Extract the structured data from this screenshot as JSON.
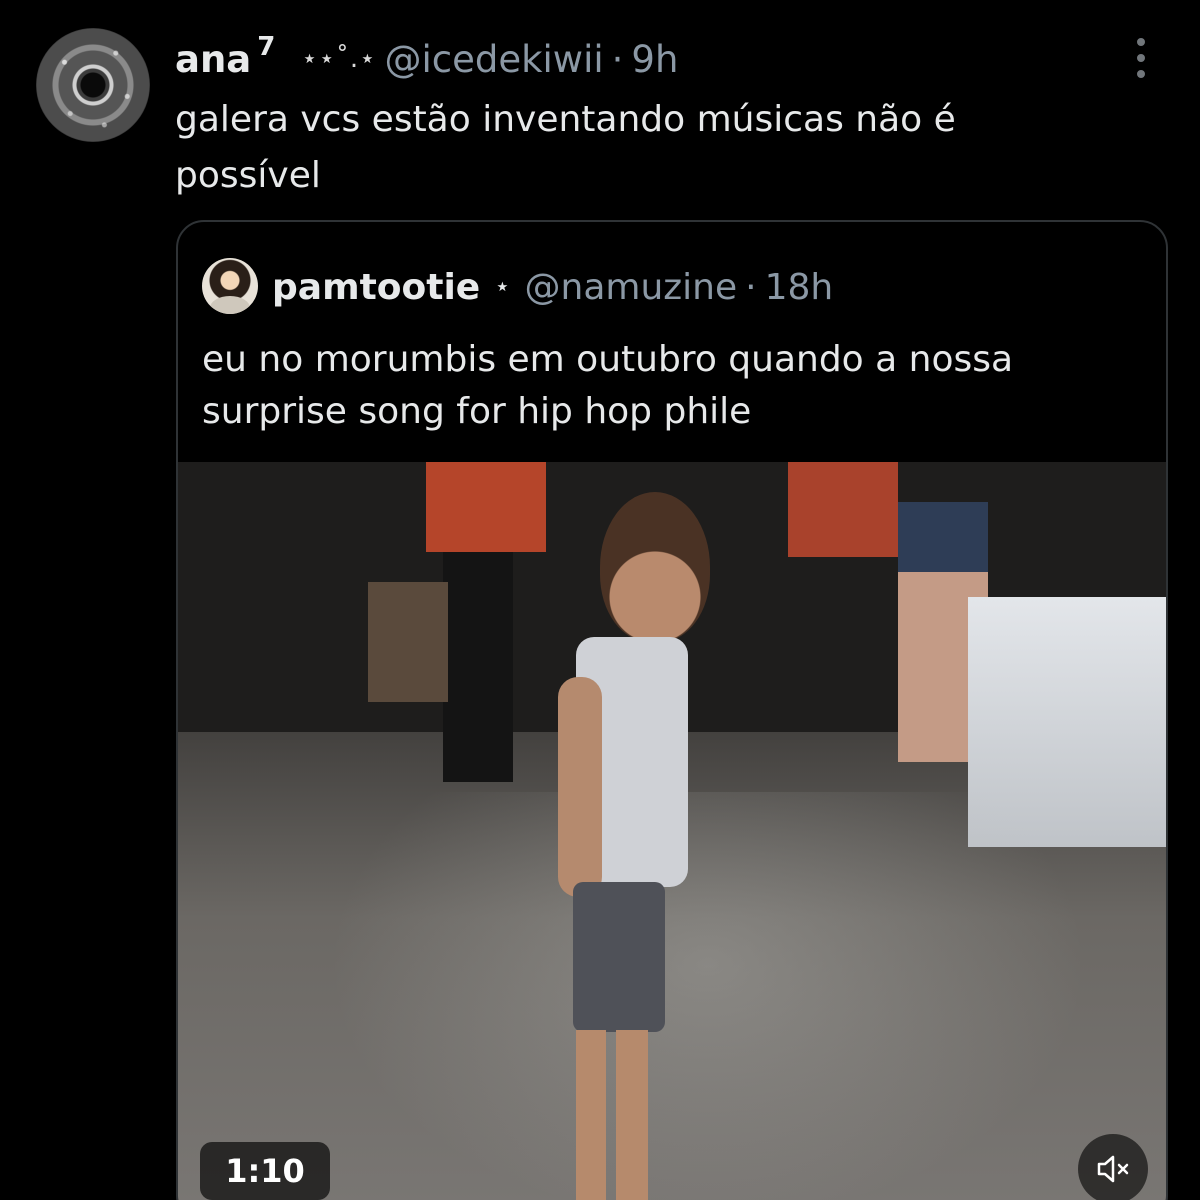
{
  "post": {
    "author_name": "ana",
    "author_badge": "7",
    "author_decor": "⋆⋆˚.⋆",
    "handle": "@icedekiwii",
    "separator": "·",
    "time": "9h",
    "text": "galera vcs estão inventando músicas não é possível"
  },
  "quote": {
    "author_name": "pamtootie",
    "author_decor": "⋆",
    "handle": "@namuzine",
    "separator": "·",
    "time": "18h",
    "text": "eu no morumbis em outubro quando a nossa surprise song for hip hop phile",
    "video_duration": "1:10"
  },
  "icons": {
    "more": "more-vertical-icon",
    "mute": "volume-muted-icon"
  },
  "colors": {
    "background": "#000000",
    "text": "#e7e9ea",
    "secondary": "#8b98a5",
    "border": "#2f3336"
  }
}
